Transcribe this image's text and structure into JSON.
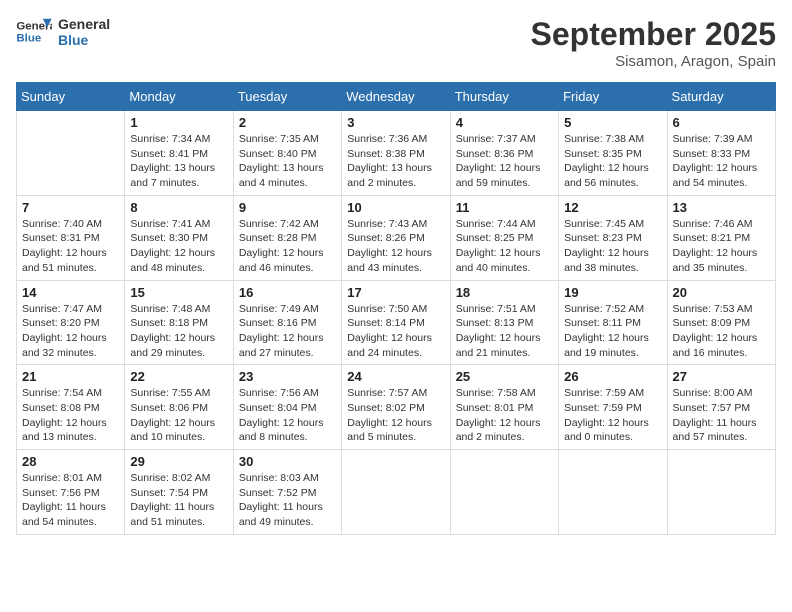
{
  "logo": {
    "name_part1": "General",
    "name_part2": "Blue"
  },
  "title": "September 2025",
  "location": "Sisamon, Aragon, Spain",
  "weekdays": [
    "Sunday",
    "Monday",
    "Tuesday",
    "Wednesday",
    "Thursday",
    "Friday",
    "Saturday"
  ],
  "weeks": [
    [
      {
        "day": "",
        "info": ""
      },
      {
        "day": "1",
        "info": "Sunrise: 7:34 AM\nSunset: 8:41 PM\nDaylight: 13 hours\nand 7 minutes."
      },
      {
        "day": "2",
        "info": "Sunrise: 7:35 AM\nSunset: 8:40 PM\nDaylight: 13 hours\nand 4 minutes."
      },
      {
        "day": "3",
        "info": "Sunrise: 7:36 AM\nSunset: 8:38 PM\nDaylight: 13 hours\nand 2 minutes."
      },
      {
        "day": "4",
        "info": "Sunrise: 7:37 AM\nSunset: 8:36 PM\nDaylight: 12 hours\nand 59 minutes."
      },
      {
        "day": "5",
        "info": "Sunrise: 7:38 AM\nSunset: 8:35 PM\nDaylight: 12 hours\nand 56 minutes."
      },
      {
        "day": "6",
        "info": "Sunrise: 7:39 AM\nSunset: 8:33 PM\nDaylight: 12 hours\nand 54 minutes."
      }
    ],
    [
      {
        "day": "7",
        "info": "Sunrise: 7:40 AM\nSunset: 8:31 PM\nDaylight: 12 hours\nand 51 minutes."
      },
      {
        "day": "8",
        "info": "Sunrise: 7:41 AM\nSunset: 8:30 PM\nDaylight: 12 hours\nand 48 minutes."
      },
      {
        "day": "9",
        "info": "Sunrise: 7:42 AM\nSunset: 8:28 PM\nDaylight: 12 hours\nand 46 minutes."
      },
      {
        "day": "10",
        "info": "Sunrise: 7:43 AM\nSunset: 8:26 PM\nDaylight: 12 hours\nand 43 minutes."
      },
      {
        "day": "11",
        "info": "Sunrise: 7:44 AM\nSunset: 8:25 PM\nDaylight: 12 hours\nand 40 minutes."
      },
      {
        "day": "12",
        "info": "Sunrise: 7:45 AM\nSunset: 8:23 PM\nDaylight: 12 hours\nand 38 minutes."
      },
      {
        "day": "13",
        "info": "Sunrise: 7:46 AM\nSunset: 8:21 PM\nDaylight: 12 hours\nand 35 minutes."
      }
    ],
    [
      {
        "day": "14",
        "info": "Sunrise: 7:47 AM\nSunset: 8:20 PM\nDaylight: 12 hours\nand 32 minutes."
      },
      {
        "day": "15",
        "info": "Sunrise: 7:48 AM\nSunset: 8:18 PM\nDaylight: 12 hours\nand 29 minutes."
      },
      {
        "day": "16",
        "info": "Sunrise: 7:49 AM\nSunset: 8:16 PM\nDaylight: 12 hours\nand 27 minutes."
      },
      {
        "day": "17",
        "info": "Sunrise: 7:50 AM\nSunset: 8:14 PM\nDaylight: 12 hours\nand 24 minutes."
      },
      {
        "day": "18",
        "info": "Sunrise: 7:51 AM\nSunset: 8:13 PM\nDaylight: 12 hours\nand 21 minutes."
      },
      {
        "day": "19",
        "info": "Sunrise: 7:52 AM\nSunset: 8:11 PM\nDaylight: 12 hours\nand 19 minutes."
      },
      {
        "day": "20",
        "info": "Sunrise: 7:53 AM\nSunset: 8:09 PM\nDaylight: 12 hours\nand 16 minutes."
      }
    ],
    [
      {
        "day": "21",
        "info": "Sunrise: 7:54 AM\nSunset: 8:08 PM\nDaylight: 12 hours\nand 13 minutes."
      },
      {
        "day": "22",
        "info": "Sunrise: 7:55 AM\nSunset: 8:06 PM\nDaylight: 12 hours\nand 10 minutes."
      },
      {
        "day": "23",
        "info": "Sunrise: 7:56 AM\nSunset: 8:04 PM\nDaylight: 12 hours\nand 8 minutes."
      },
      {
        "day": "24",
        "info": "Sunrise: 7:57 AM\nSunset: 8:02 PM\nDaylight: 12 hours\nand 5 minutes."
      },
      {
        "day": "25",
        "info": "Sunrise: 7:58 AM\nSunset: 8:01 PM\nDaylight: 12 hours\nand 2 minutes."
      },
      {
        "day": "26",
        "info": "Sunrise: 7:59 AM\nSunset: 7:59 PM\nDaylight: 12 hours\nand 0 minutes."
      },
      {
        "day": "27",
        "info": "Sunrise: 8:00 AM\nSunset: 7:57 PM\nDaylight: 11 hours\nand 57 minutes."
      }
    ],
    [
      {
        "day": "28",
        "info": "Sunrise: 8:01 AM\nSunset: 7:56 PM\nDaylight: 11 hours\nand 54 minutes."
      },
      {
        "day": "29",
        "info": "Sunrise: 8:02 AM\nSunset: 7:54 PM\nDaylight: 11 hours\nand 51 minutes."
      },
      {
        "day": "30",
        "info": "Sunrise: 8:03 AM\nSunset: 7:52 PM\nDaylight: 11 hours\nand 49 minutes."
      },
      {
        "day": "",
        "info": ""
      },
      {
        "day": "",
        "info": ""
      },
      {
        "day": "",
        "info": ""
      },
      {
        "day": "",
        "info": ""
      }
    ]
  ]
}
